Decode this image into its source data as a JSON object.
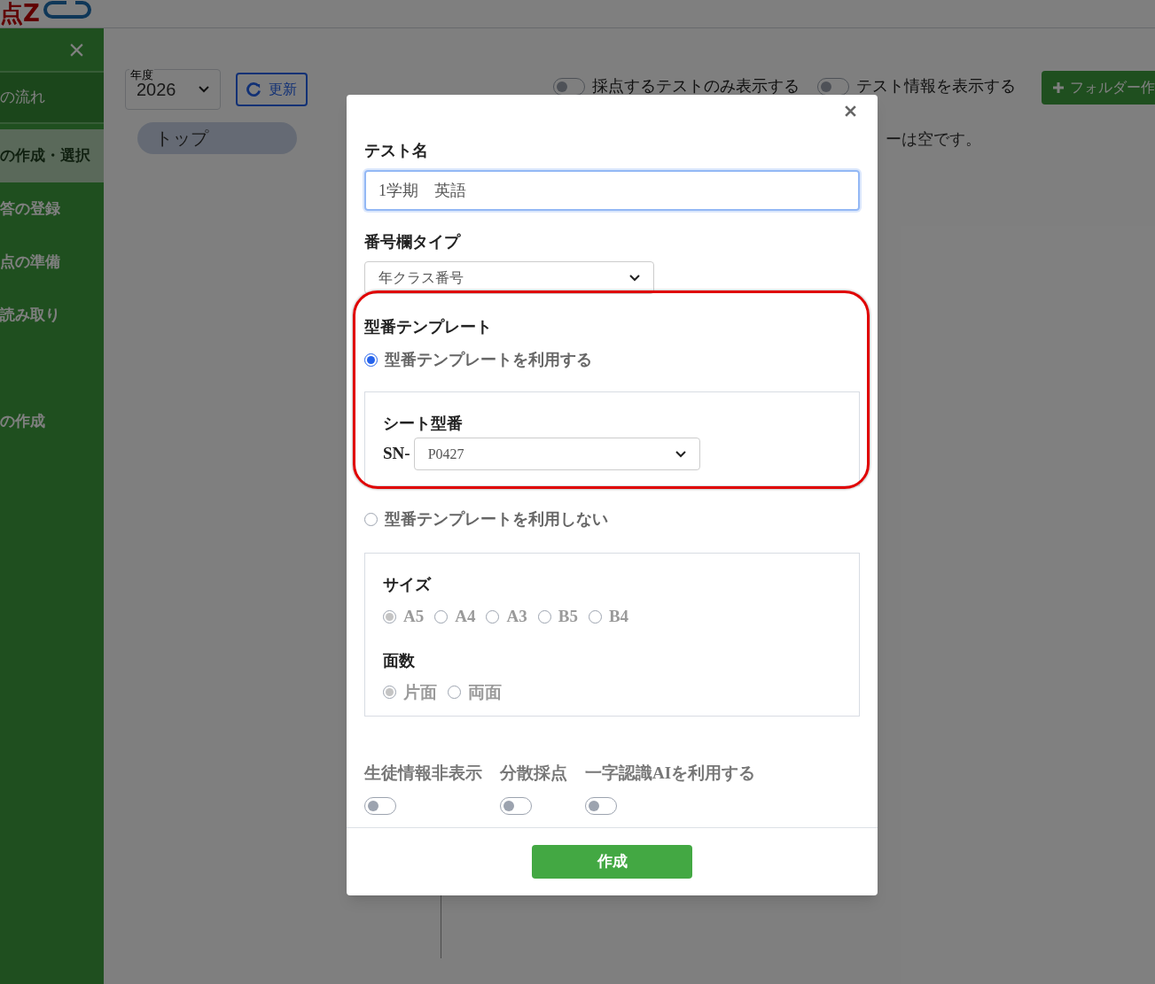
{
  "header": {
    "logo": "点Z"
  },
  "sidebar": {
    "items": [
      {
        "label": "の流れ",
        "selected": false
      },
      {
        "label": "の作成・選択",
        "selected": true
      },
      {
        "label": "答の登録",
        "selected": false
      },
      {
        "label": "点の準備",
        "selected": false
      },
      {
        "label": "読み取り",
        "selected": false
      },
      {
        "label": "の作成",
        "selected": false
      }
    ]
  },
  "toolbar": {
    "year": {
      "label": "年度",
      "value": "2026"
    },
    "refresh_button": "更新",
    "breadcrumb": "トップ",
    "toggles": [
      {
        "label": "採点するテストのみ表示する",
        "on": false
      },
      {
        "label": "テスト情報を表示する",
        "on": false
      }
    ],
    "folder_button": "フォルダー作",
    "empty_message": "ーは空です。"
  },
  "dialog": {
    "test_name": {
      "label": "テスト名",
      "value": "1学期　英語"
    },
    "number_type": {
      "label": "番号欄タイプ",
      "value": "年クラス番号"
    },
    "template": {
      "label": "型番テンプレート",
      "options": [
        {
          "label": "型番テンプレートを利用する",
          "selected": true
        },
        {
          "label": "型番テンプレートを利用しない",
          "selected": false
        }
      ],
      "sheet": {
        "label": "シート型番",
        "prefix": "SN-",
        "value": "P0427"
      },
      "size": {
        "label": "サイズ",
        "disabled": true,
        "options": [
          {
            "label": "A5",
            "selected": true
          },
          {
            "label": "A4",
            "selected": false
          },
          {
            "label": "A3",
            "selected": false
          },
          {
            "label": "B5",
            "selected": false
          },
          {
            "label": "B4",
            "selected": false
          }
        ]
      },
      "sides": {
        "label": "面数",
        "disabled": true,
        "options": [
          {
            "label": "片面",
            "selected": true
          },
          {
            "label": "両面",
            "selected": false
          }
        ]
      }
    },
    "toggles": [
      {
        "label": "生徒情報非表示",
        "on": false
      },
      {
        "label": "分散採点",
        "on": false
      },
      {
        "label": "一字認識AIを利用する",
        "on": false
      }
    ],
    "submit": "作成"
  }
}
